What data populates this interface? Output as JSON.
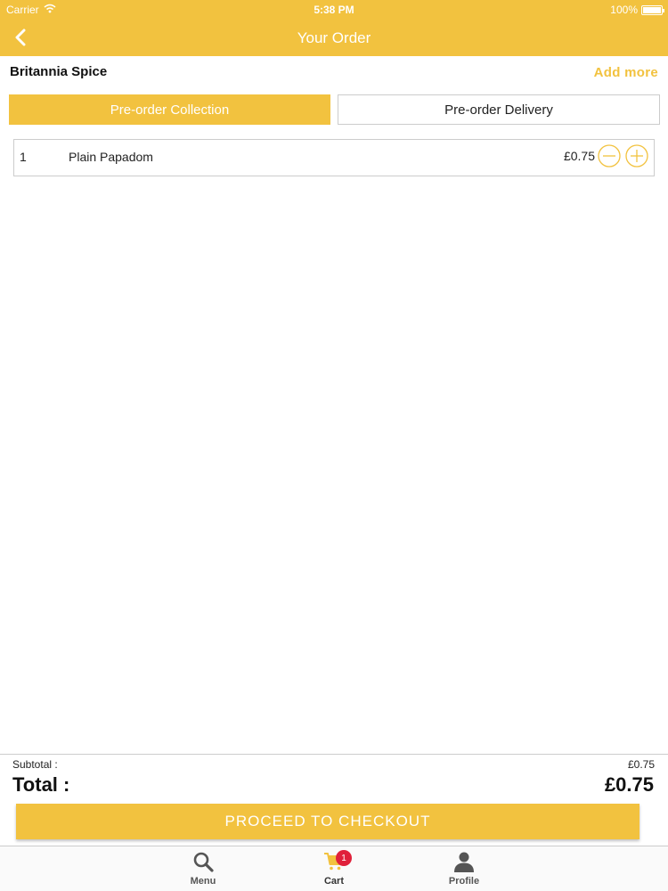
{
  "status_bar": {
    "carrier": "Carrier",
    "time": "5:38 PM",
    "battery": "100%"
  },
  "nav": {
    "title": "Your Order"
  },
  "restaurant": {
    "name": "Britannia Spice",
    "add_more_label": "Add more"
  },
  "order_type": {
    "collection_label": "Pre-order Collection",
    "delivery_label": "Pre-order Delivery",
    "selected": "collection"
  },
  "items": [
    {
      "qty": "1",
      "name": "Plain Papadom",
      "price": "£0.75"
    }
  ],
  "summary": {
    "subtotal_label": "Subtotal :",
    "subtotal_value": "£0.75",
    "total_label": "Total :",
    "total_value": "£0.75"
  },
  "checkout": {
    "label": "PROCEED TO CHECKOUT"
  },
  "tabs": [
    {
      "label": "Menu"
    },
    {
      "label": "Cart",
      "badge": "1"
    },
    {
      "label": "Profile"
    }
  ],
  "colors": {
    "accent": "#f2c23f",
    "badge": "#e0213a"
  }
}
